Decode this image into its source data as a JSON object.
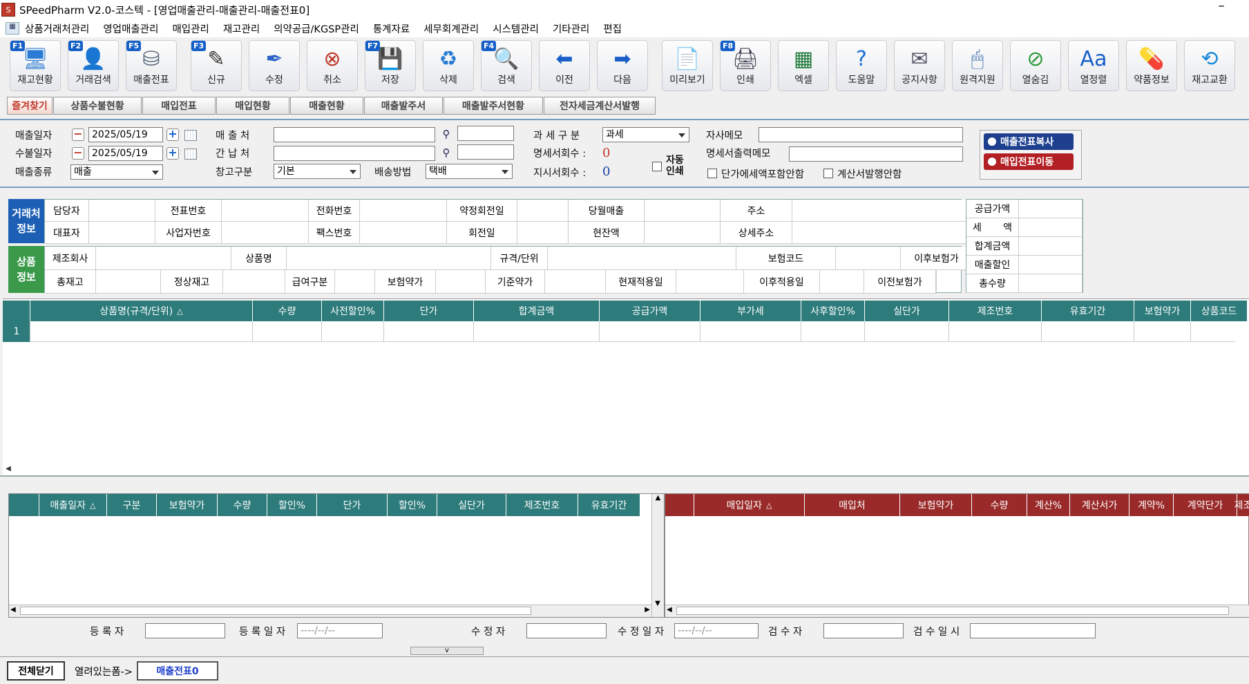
{
  "window": {
    "title": "SPeedPharm V2.0-코스텍 - [영업매출관리-매출관리-매출전표0]",
    "minimize_label": "–"
  },
  "menu": {
    "items": [
      "상품거래처관리",
      "영업매출관리",
      "매입관리",
      "재고관리",
      "의약공급/KGSP관리",
      "통계자료",
      "세무회계관리",
      "시스템관리",
      "기타관리",
      "편집"
    ]
  },
  "toolbar": {
    "buttons": [
      {
        "label": "재고현황",
        "fkey": "F1",
        "icon": "monitor-icon",
        "color": "#2a7bd4"
      },
      {
        "label": "거래검색",
        "fkey": "F2",
        "icon": "user-search-icon",
        "color": "#3a8ad8"
      },
      {
        "label": "매출전표",
        "fkey": "F5",
        "icon": "coins-icon",
        "color": "#5a6b7c"
      },
      {
        "label": "신규",
        "fkey": "F3",
        "icon": "notepad-icon",
        "color": "#333"
      },
      {
        "label": "수정",
        "fkey": "",
        "icon": "pen-icon",
        "color": "#2a62c8"
      },
      {
        "label": "취소",
        "fkey": "",
        "icon": "cancel-icon",
        "color": "#c0392b"
      },
      {
        "label": "저장",
        "fkey": "F7",
        "icon": "save-icon",
        "color": "#1560c8"
      },
      {
        "label": "삭제",
        "fkey": "",
        "icon": "recycle-icon",
        "color": "#2a7bd4"
      },
      {
        "label": "검색",
        "fkey": "F4",
        "icon": "magnifier-icon",
        "color": "#444"
      },
      {
        "label": "이전",
        "fkey": "",
        "icon": "arrow-left-icon",
        "color": "#1a5fc8"
      },
      {
        "label": "다음",
        "fkey": "",
        "icon": "arrow-right-icon",
        "color": "#1a5fc8"
      },
      {
        "label": "미리보기",
        "fkey": "",
        "icon": "preview-icon",
        "color": "#667"
      },
      {
        "label": "인쇄",
        "fkey": "F8",
        "icon": "printer-icon",
        "color": "#445"
      },
      {
        "label": "엑셀",
        "fkey": "",
        "icon": "excel-icon",
        "color": "#1f7a3a"
      },
      {
        "label": "도움말",
        "fkey": "",
        "icon": "help-icon",
        "color": "#1a6fd8"
      },
      {
        "label": "공지사항",
        "fkey": "",
        "icon": "notice-icon",
        "color": "#556"
      },
      {
        "label": "원격지원",
        "fkey": "",
        "icon": "remote-icon",
        "color": "#2a5fa8"
      },
      {
        "label": "열숨김",
        "fkey": "",
        "icon": "hide-column-icon",
        "color": "#2a9a3a"
      },
      {
        "label": "열정렬",
        "fkey": "",
        "icon": "font-icon",
        "color": "#1a5fc8"
      },
      {
        "label": "약품정보",
        "fkey": "",
        "icon": "pill-icon",
        "color": "#d8342a"
      },
      {
        "label": "재고교환",
        "fkey": "",
        "icon": "exchange-icon",
        "color": "#1a8ad8"
      }
    ]
  },
  "tabs": [
    "즐겨찾기",
    "상품수불현황",
    "매입전표",
    "매입현황",
    "매출현황",
    "매출발주서",
    "매출발주서현황",
    "전자세금계산서발행"
  ],
  "form": {
    "sales_date_label": "매출일자",
    "sales_date": "2025/05/19",
    "receipt_date_label": "수불일자",
    "receipt_date": "2025/05/19",
    "sales_type_label": "매출종류",
    "sales_type": "매출",
    "customer_label": "매 출 처",
    "payer_label": "간 납 처",
    "warehouse_label": "창고구분",
    "warehouse": "기본",
    "delivery_label": "배송방법",
    "delivery": "택배",
    "tax_label": "과 세 구 분",
    "tax": "과세",
    "stmt_count_label": "명세서회수 :",
    "stmt_count": "0",
    "order_count_label": "지시서회수 :",
    "order_count": "0",
    "auto_print_label": "자동\n인쇄",
    "memo_label": "자사메모",
    "print_memo_label": "명세서출력메모",
    "chk_tax_label": "단가에세액포함안함",
    "chk_invoice_label": "계산서발행안함",
    "copy_btn": "매출전표복사",
    "move_btn": "매입전표이동"
  },
  "customer_info": {
    "side": "거래처\n정보",
    "row1": [
      "담당자",
      "전표번호",
      "전화번호",
      "약정회전일",
      "당월매출",
      "주소"
    ],
    "row2": [
      "대표자",
      "사업자번호",
      "팩스번호",
      "회전일",
      "현잔액",
      "상세주소"
    ]
  },
  "product_info": {
    "side": "상품\n정보",
    "row1": [
      "제조회사",
      "상품명",
      "규격/단위",
      "보험코드",
      "이후보험가"
    ],
    "row2": [
      "총재고",
      "정상재고",
      "급여구분",
      "보험약가",
      "기준약가",
      "현재적용일",
      "이후적용일",
      "이전보험가"
    ]
  },
  "totals": {
    "labels": [
      "공급가액",
      "세       액",
      "합계금액",
      "매출할인",
      "총수량"
    ]
  },
  "grid": {
    "columns": [
      "상품명(규격/단위)",
      "수량",
      "사전할인%",
      "단가",
      "합계금액",
      "공급가액",
      "부가세",
      "사후할인%",
      "실단가",
      "제조번호",
      "유효기간",
      "보험약가",
      "상품코드"
    ],
    "row_number": "1"
  },
  "sales_history": {
    "columns": [
      "매출일자",
      "구분",
      "보험약가",
      "수량",
      "할인%",
      "단가",
      "할인%",
      "실단가",
      "제조번호",
      "유효기간"
    ]
  },
  "purchase_history": {
    "columns": [
      "매입일자",
      "매입처",
      "보험약가",
      "수량",
      "계산%",
      "계산서가",
      "계약%",
      "계약단가",
      "제조"
    ]
  },
  "footer": {
    "reg_user_label": "등  록  자",
    "reg_date_label": "등 록 일 자",
    "reg_date": "----/--/--",
    "mod_user_label": "수  정  자",
    "mod_date_label": "수 정 일 자",
    "mod_date": "----/--/--",
    "chk_user_label": "검  수  자",
    "chk_date_label": "검 수 일 시",
    "collapse_label": "v"
  },
  "taskbar": {
    "close_all": "전체닫기",
    "open_forms_label": "열려있는폼->",
    "open_form": "매출전표0"
  },
  "colors": {
    "grid_header": "#2d7b7b",
    "sales_header": "#2d7b7b",
    "purchase_header": "#9a2a2a",
    "side_blue": "#1d5fb4",
    "side_green": "#3a9a4a"
  }
}
